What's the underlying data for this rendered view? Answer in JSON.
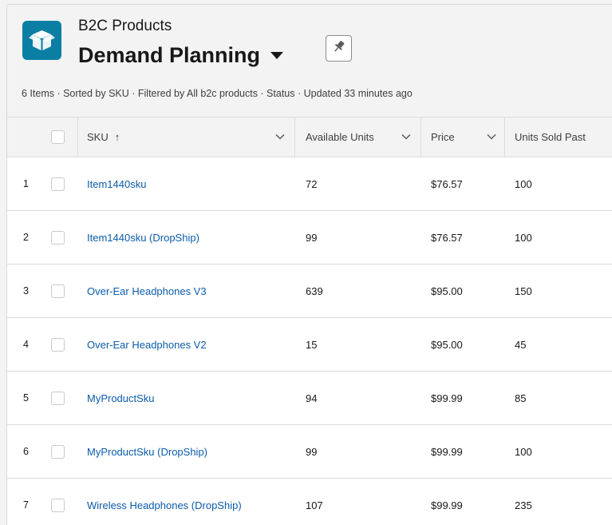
{
  "header": {
    "object_label": "B2C Products",
    "title": "Demand Planning",
    "meta": "6 Items · Sorted by SKU · Filtered by All b2c products · Status · Updated 33 minutes ago"
  },
  "icons": {
    "object": "box-icon",
    "title_menu": "caret-down-icon",
    "pin": "pin-icon",
    "sort": "arrow-up-icon",
    "column_menu": "chevron-down-icon"
  },
  "colors": {
    "object_icon_bg": "#0a7ea3",
    "link": "#0b5cab",
    "header_bg": "#f3f3f3",
    "border": "#dddbda"
  },
  "table": {
    "columns": [
      "SKU",
      "Available Units",
      "Price",
      "Units Sold Past"
    ],
    "sort_indicator": "↑",
    "rows": [
      {
        "num": "1",
        "sku": "Item1440sku",
        "available": "72",
        "price": "$76.57",
        "sold": "100"
      },
      {
        "num": "2",
        "sku": "Item1440sku (DropShip)",
        "available": "99",
        "price": "$76.57",
        "sold": "100"
      },
      {
        "num": "3",
        "sku": "Over-Ear Headphones V3",
        "available": "639",
        "price": "$95.00",
        "sold": "150"
      },
      {
        "num": "4",
        "sku": "Over-Ear Headphones V2",
        "available": "15",
        "price": "$95.00",
        "sold": "45"
      },
      {
        "num": "5",
        "sku": "MyProductSku",
        "available": "94",
        "price": "$99.99",
        "sold": "85"
      },
      {
        "num": "6",
        "sku": "MyProductSku (DropShip)",
        "available": "99",
        "price": "$99.99",
        "sold": "100"
      },
      {
        "num": "7",
        "sku": "Wireless Headphones (DropShip)",
        "available": "107",
        "price": "$99.99",
        "sold": "235"
      }
    ]
  }
}
